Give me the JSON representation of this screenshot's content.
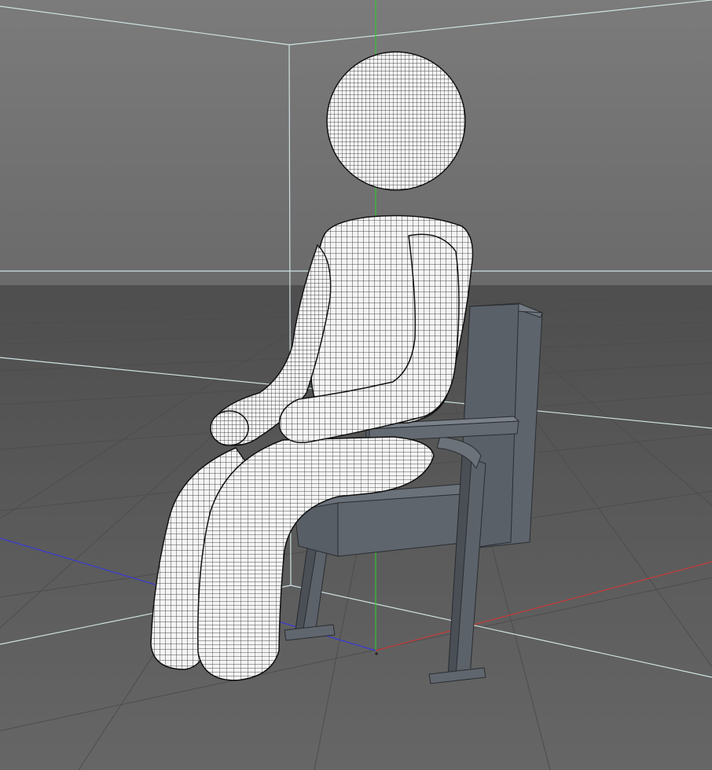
{
  "viewport": {
    "background_top": "#7a7a7a",
    "background_bottom": "#595959",
    "floor_color": "#5e5e5e",
    "grid_color": "#4a4a4a",
    "bounding_box_color": "#cfe6e6",
    "axis_x_color": "#c83232",
    "axis_y_color": "#32c832",
    "axis_z_color": "#3232d8",
    "mesh_fill": "#f4f4f4",
    "mesh_line": "#1a1a1a",
    "chair_face": "#5d636b",
    "chair_dark": "#474c53",
    "chair_light": "#6c737b"
  },
  "objects": [
    {
      "id": "figure-head",
      "icon": "sphere-mesh"
    },
    {
      "id": "figure-torso",
      "icon": "capsule-mesh"
    },
    {
      "id": "figure-arms",
      "icon": "capsule-mesh"
    },
    {
      "id": "figure-legs",
      "icon": "capsule-mesh"
    },
    {
      "id": "chair",
      "icon": "box-mesh"
    }
  ]
}
